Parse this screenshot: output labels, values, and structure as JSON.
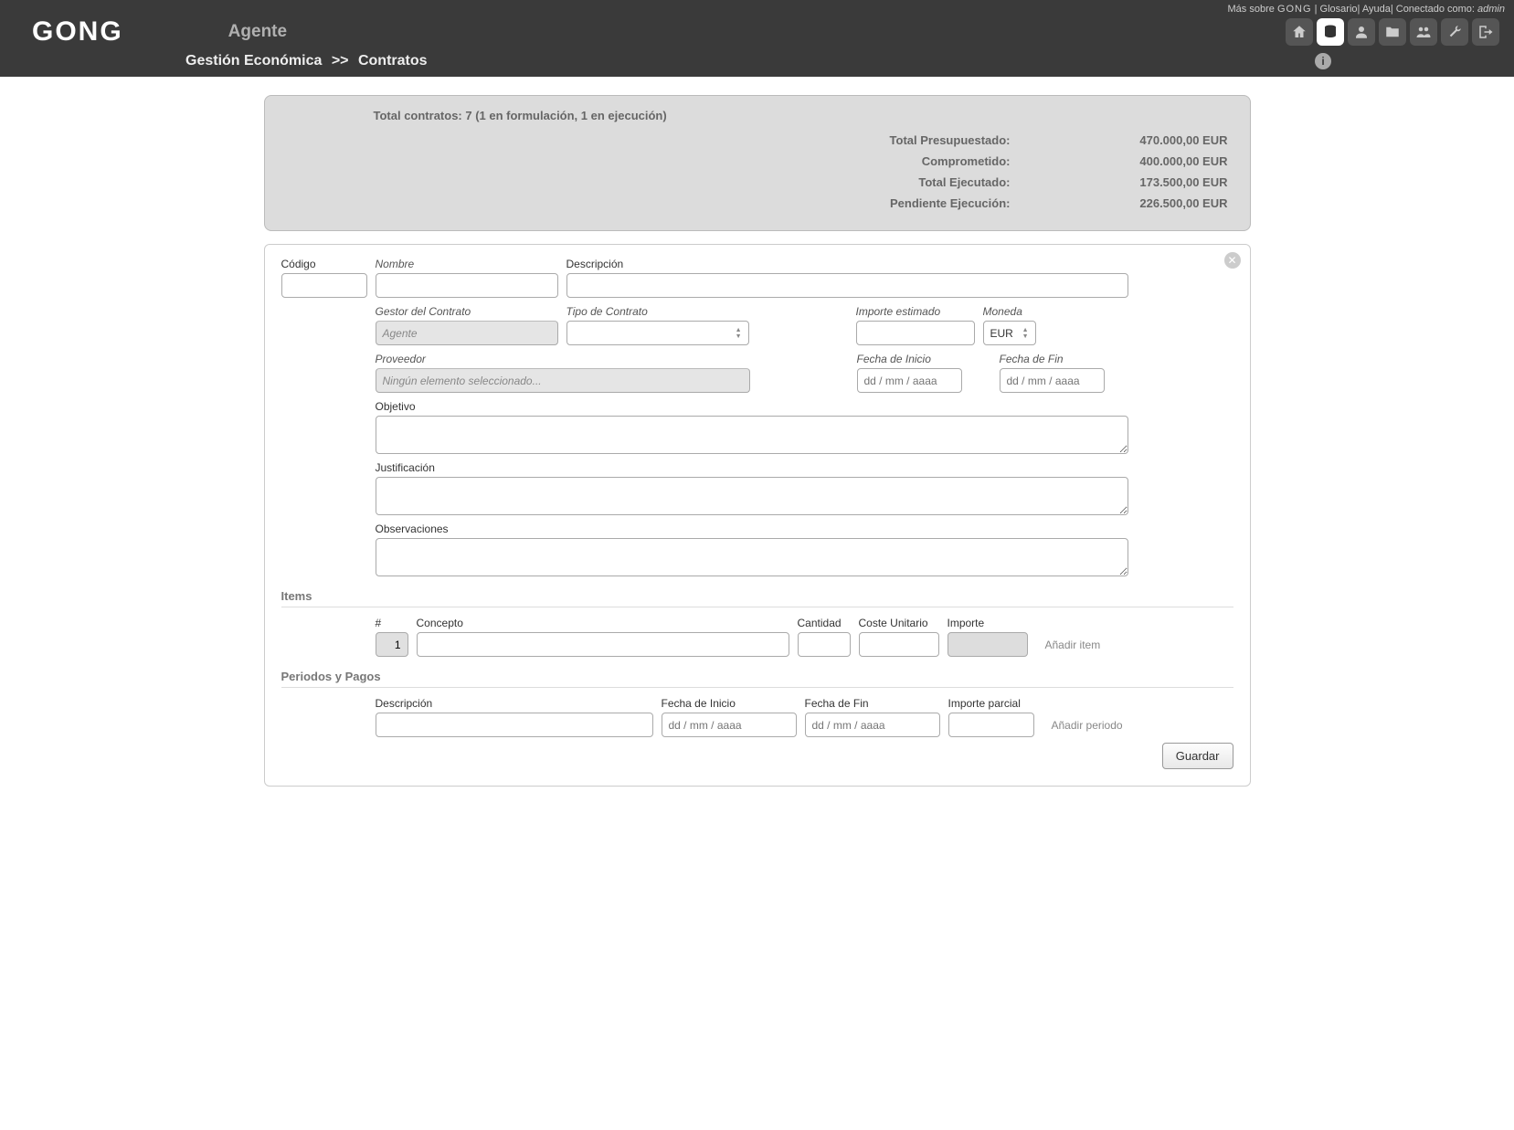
{
  "meta": {
    "mas_sobre": "Más sobre",
    "gong": "GONG",
    "glosario": "Glosario",
    "ayuda": "Ayuda",
    "conectado_como": "Conectado como:",
    "admin": "admin"
  },
  "header": {
    "logo": "GONG",
    "agente": "Agente"
  },
  "breadcrumb": {
    "part1": "Gestión Económica",
    "sep": ">>",
    "part2": "Contratos"
  },
  "summary": {
    "title": "Total contratos: 7 (1 en formulación, 1 en ejecución)",
    "rows": [
      {
        "label": "Total Presupuestado:",
        "value": "470.000,00 EUR"
      },
      {
        "label": "Comprometido:",
        "value": "400.000,00 EUR"
      },
      {
        "label": "Total Ejecutado:",
        "value": "173.500,00 EUR"
      },
      {
        "label": "Pendiente Ejecución:",
        "value": "226.500,00 EUR"
      }
    ]
  },
  "form": {
    "codigo_label": "Código",
    "nombre_label": "Nombre",
    "descripcion_label": "Descripción",
    "gestor_label": "Gestor del Contrato",
    "gestor_value": "Agente",
    "tipo_label": "Tipo de Contrato",
    "importe_label": "Importe estimado",
    "moneda_label": "Moneda",
    "moneda_value": "EUR",
    "proveedor_label": "Proveedor",
    "proveedor_placeholder": "Ningún elemento seleccionado...",
    "fecha_inicio_label": "Fecha de Inicio",
    "fecha_fin_label": "Fecha de Fin",
    "date_placeholder": "dd / mm / aaaa",
    "objetivo_label": "Objetivo",
    "justificacion_label": "Justificación",
    "observaciones_label": "Observaciones"
  },
  "items": {
    "title": "Items",
    "num_label": "#",
    "num_value": "1",
    "concepto_label": "Concepto",
    "cantidad_label": "Cantidad",
    "coste_label": "Coste Unitario",
    "importe_label": "Importe",
    "add": "Añadir item"
  },
  "periodos": {
    "title": "Periodos y Pagos",
    "descripcion_label": "Descripción",
    "fecha_inicio_label": "Fecha de Inicio",
    "fecha_fin_label": "Fecha de Fin",
    "importe_label": "Importe parcial",
    "add": "Añadir periodo",
    "date_placeholder": "dd / mm / aaaa"
  },
  "buttons": {
    "guardar": "Guardar"
  }
}
